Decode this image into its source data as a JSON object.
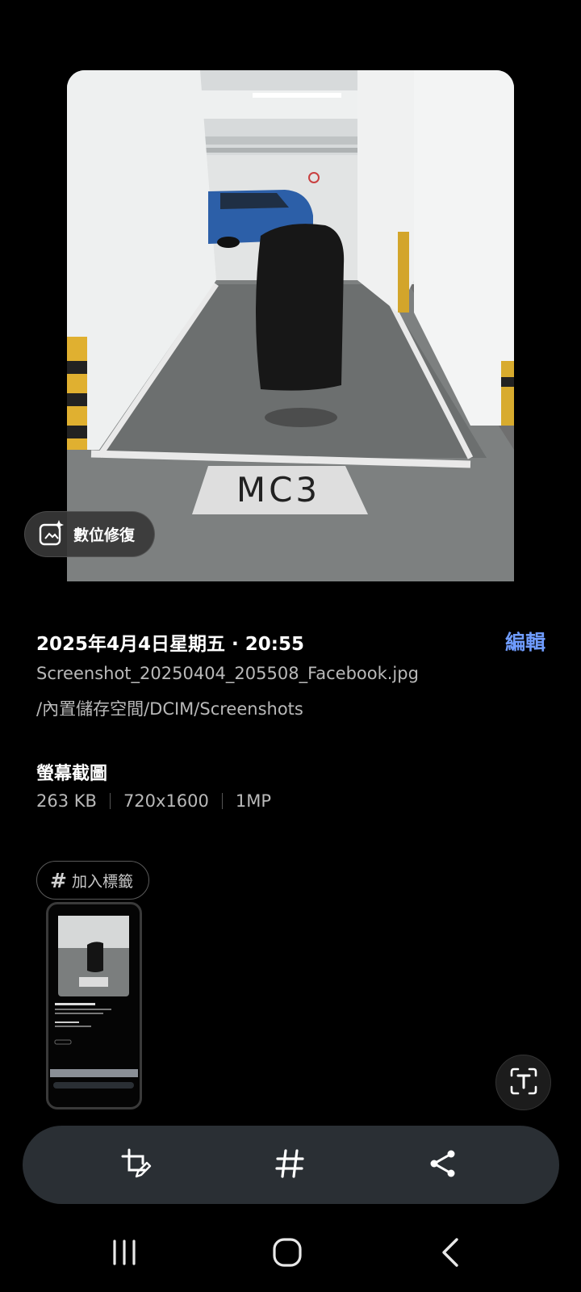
{
  "photo": {
    "caption_overlay": "MC3"
  },
  "remaster": {
    "icon": "sparkle-image-icon",
    "label": "數位修復"
  },
  "details": {
    "datetime": "2025年4月4日星期五 · 20:55",
    "edit_label": "編輯",
    "filename": "Screenshot_20250404_205508_Facebook.jpg",
    "path": "/內置儲存空間/DCIM/Screenshots",
    "type": "螢幕截圖",
    "size": "263 KB",
    "resolution": "720x1600",
    "megapixels": "1MP"
  },
  "tags": {
    "add_label": "加入標籤",
    "icon": "hashtag-icon"
  },
  "toolbar": {
    "items": [
      "crop-edit-icon",
      "hashtag-icon",
      "share-icon"
    ]
  },
  "text_extract": {
    "icon": "text-scan-icon"
  },
  "navigation": {
    "items": [
      "recent-apps-icon",
      "home-icon",
      "back-icon"
    ]
  },
  "colors": {
    "accent": "#6f9cff",
    "toolbar_bg": "#2a2f34",
    "background": "#000000"
  }
}
